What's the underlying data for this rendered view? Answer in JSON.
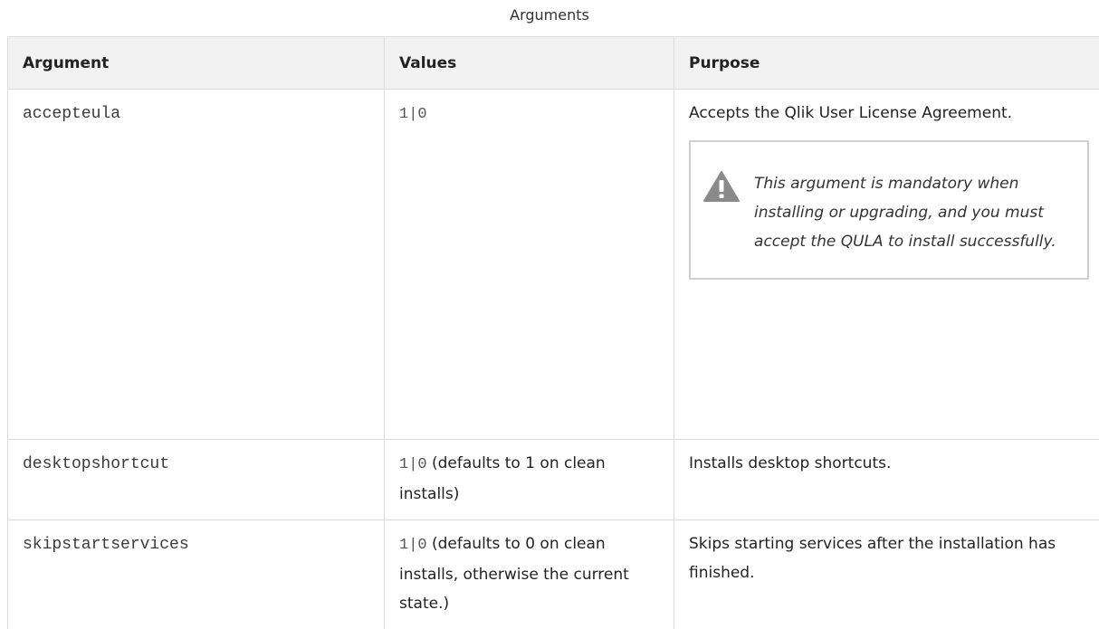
{
  "caption": "Arguments",
  "headers": {
    "argument": "Argument",
    "values": "Values",
    "purpose": "Purpose"
  },
  "rows": [
    {
      "argument": "accepteula",
      "values_code": "1|0",
      "values_text": "",
      "purpose": "Accepts the Qlik User License Agreement.",
      "note": "This argument is mandatory when installing or upgrading, and you must accept the QULA to install successfully.",
      "note_icon": "warning-icon"
    },
    {
      "argument": "desktopshortcut",
      "values_code": "1|0",
      "values_text": " (defaults to 1 on clean installs)",
      "purpose": "Installs desktop shortcuts."
    },
    {
      "argument": "skipstartservices",
      "values_code": "1|0",
      "values_text": " (defaults to 0 on clean installs, otherwise the current state.)",
      "purpose": "Skips starting services after the installation has finished."
    }
  ],
  "colors": {
    "header_bg": "#f2f2f2",
    "border": "#dcdcdc",
    "icon": "#8a8a8a"
  }
}
